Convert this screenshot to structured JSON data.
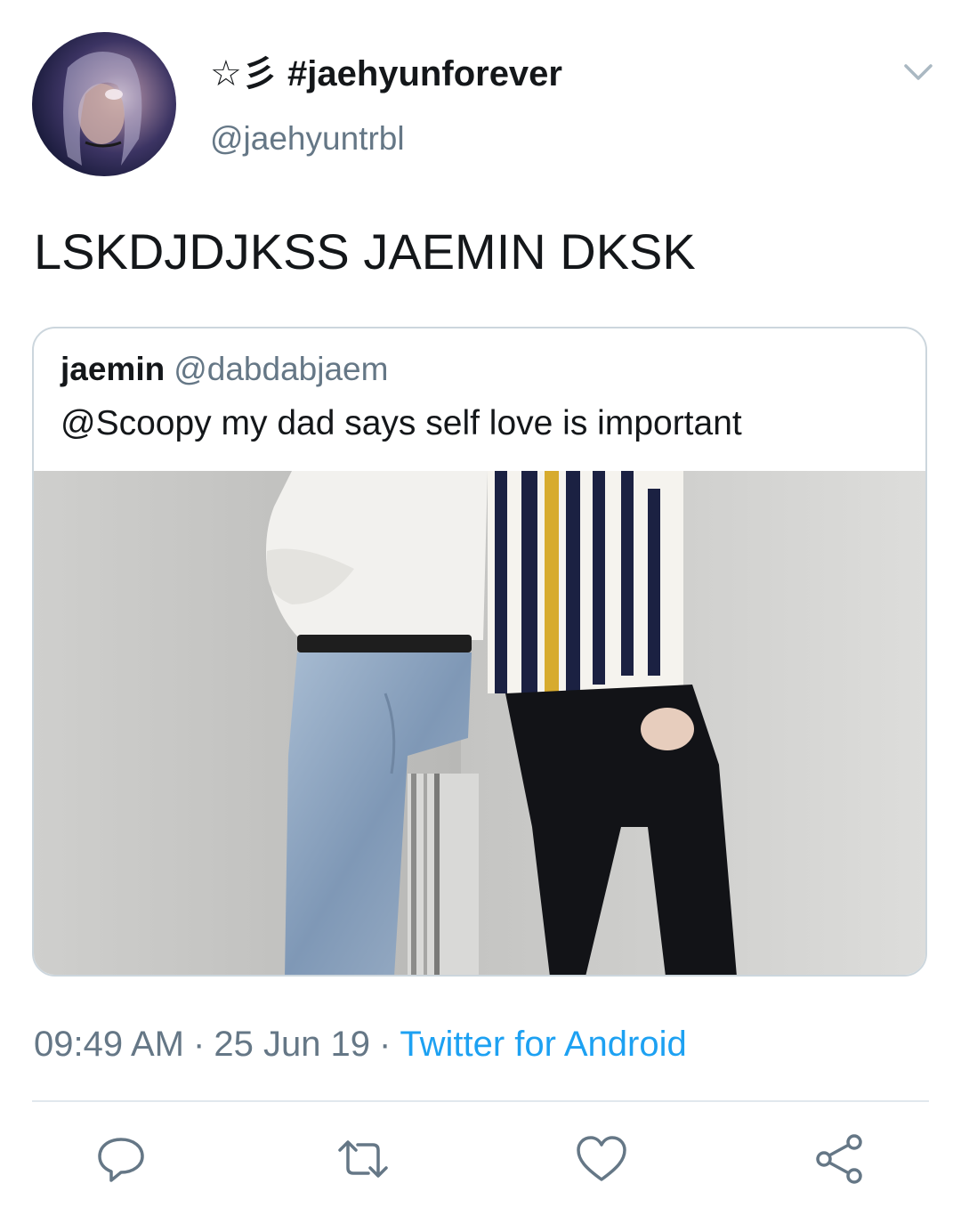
{
  "tweet": {
    "author": {
      "display_name": "☆彡 #jaehyunforever",
      "handle": "@jaehyuntrbl"
    },
    "text": "LSKDJDJKSS JAEMIN DKSK",
    "quoted_tweet": {
      "author_name": "jaemin",
      "author_handle": "@dabdabjaem",
      "text": "@Scoopy my dad says self love is important"
    },
    "meta": {
      "time": "09:49 AM",
      "separator": "·",
      "date": "25 Jun 19",
      "source": "Twitter for Android"
    },
    "actions": {
      "reply_icon": "reply-icon",
      "retweet_icon": "retweet-icon",
      "like_icon": "heart-icon",
      "share_icon": "share-icon"
    }
  },
  "colors": {
    "text": "#14171a",
    "secondary": "#657786",
    "link": "#1da1f2",
    "border": "#ccd6dd",
    "divider": "#e1e8ed"
  }
}
